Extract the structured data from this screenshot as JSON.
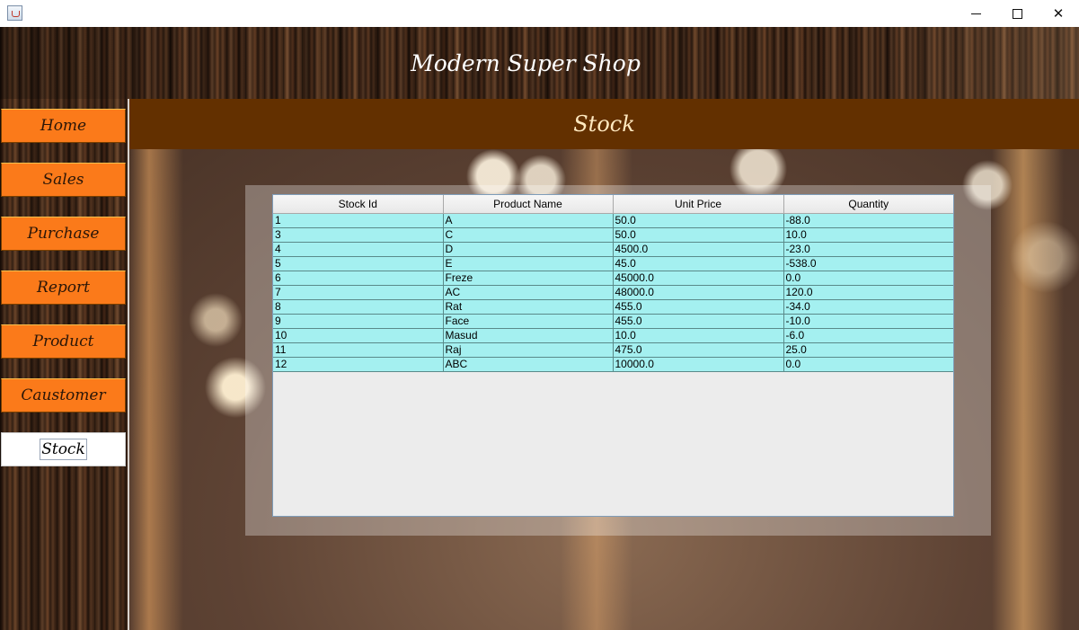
{
  "window": {
    "icon": "java-cup-icon",
    "controls": {
      "minimize": "minimize-icon",
      "maximize": "maximize-icon",
      "close": "close-icon"
    },
    "close_glyph": "✕"
  },
  "header": {
    "title": "Modern Super Shop"
  },
  "sidebar": {
    "items": [
      {
        "label": "Home",
        "active": false
      },
      {
        "label": "Sales",
        "active": false
      },
      {
        "label": "Purchase",
        "active": false
      },
      {
        "label": "Report",
        "active": false
      },
      {
        "label": "Product",
        "active": false
      },
      {
        "label": "Caustomer",
        "active": false
      },
      {
        "label": "Stock",
        "active": true
      }
    ]
  },
  "section": {
    "title": "Stock"
  },
  "table": {
    "columns": [
      "Stock Id",
      "Product Name",
      "Unit Price",
      "Quantity"
    ],
    "rows": [
      [
        "1",
        "A",
        "50.0",
        "-88.0"
      ],
      [
        "3",
        "C",
        "50.0",
        "10.0"
      ],
      [
        "4",
        "D",
        "4500.0",
        "-23.0"
      ],
      [
        "5",
        "E",
        "45.0",
        "-538.0"
      ],
      [
        "6",
        "Freze",
        "45000.0",
        "0.0"
      ],
      [
        "7",
        "AC",
        "48000.0",
        "120.0"
      ],
      [
        "8",
        "Rat",
        "455.0",
        "-34.0"
      ],
      [
        "9",
        "Face",
        "455.0",
        "-10.0"
      ],
      [
        "10",
        "Masud",
        "10.0",
        "-6.0"
      ],
      [
        "11",
        "Raj",
        "475.0",
        "25.0"
      ],
      [
        "12",
        "ABC",
        "10000.0",
        "0.0"
      ]
    ]
  },
  "colors": {
    "nav_button": "#fb7a1a",
    "section_header": "#633000",
    "row_background": "#a4f0f0"
  }
}
